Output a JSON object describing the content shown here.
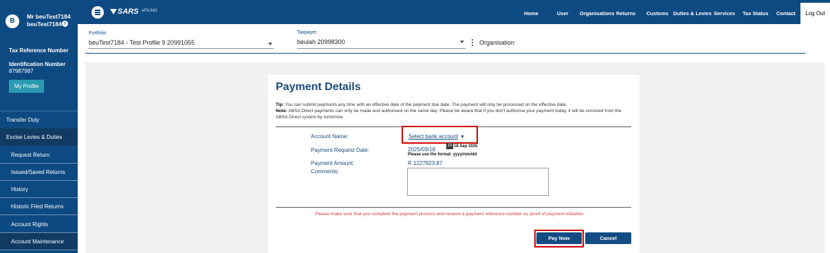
{
  "sidebar": {
    "avatar_letter": "B",
    "user_name_line1": "Mr beuTest7184",
    "user_name_line2": "beuTest7184",
    "tax_ref_label": "Tax Reference Number",
    "id_label": "Identification Number",
    "id_value": "87987987",
    "my_profile": "My Profile",
    "items": [
      {
        "label": "Transfer Duty"
      },
      {
        "label": "Excise Levies & Duties"
      },
      {
        "label": "Request Return"
      },
      {
        "label": "Issued/Saved Returns"
      },
      {
        "label": "History"
      },
      {
        "label": "Historic Filed Returns"
      },
      {
        "label": "Account Rights"
      },
      {
        "label": "Account Maintenance"
      }
    ]
  },
  "header": {
    "logo_text": "SARS",
    "efiling_text": "eFILING",
    "nav": [
      "Home",
      "User",
      "Organisations",
      "Returns",
      "Customs",
      "Duties & Levies",
      "Services",
      "Tax Status",
      "Contact"
    ],
    "logout": "Log Out"
  },
  "selectors": {
    "portfolio_label": "Portfolio",
    "portfolio_value": "beuTest7184 - Test Profile 9 20991055",
    "taxpayer_label": "Taxpayer",
    "taxpayer_value": "beulah 20998300",
    "organisation": "Organisation"
  },
  "payment": {
    "title": "Payment Details",
    "tip_label": "Tip:",
    "tip_text": " You can submit payments any time with an effective date of the payment due date. The payment will only be processed on the effective date.",
    "note_label": "Note:",
    "note_text": " ABSA Direct payments can only be made and authorised on the same day. Please be aware that if you don't authorise your payment today, it will be removed from the ABSA Direct system by tomorrow.",
    "account_name_label": "Account Name:",
    "select_bank": "Select bank account",
    "request_date_label": "Payment Request Date:",
    "request_date_value": "2025/09/18",
    "calendar_icon_text": "18",
    "calendar_text": "18 Sep 2025",
    "format_hint": "Please use the format: yyyy/mm/dd",
    "amount_label": "Payment Amount:",
    "amount_value": "R 1227823.87",
    "comments_label": "Comments:",
    "notice": "Please make sure that you complete the payment process and receive a payment reference number as proof of payment initiation.",
    "pay_now": "Pay Now",
    "cancel": "Cancel"
  },
  "colors": {
    "brand_blue": "#0e4a82",
    "highlight_red": "#d10000",
    "notice_red": "#d0353a",
    "teal_button": "#2a9ab1"
  }
}
